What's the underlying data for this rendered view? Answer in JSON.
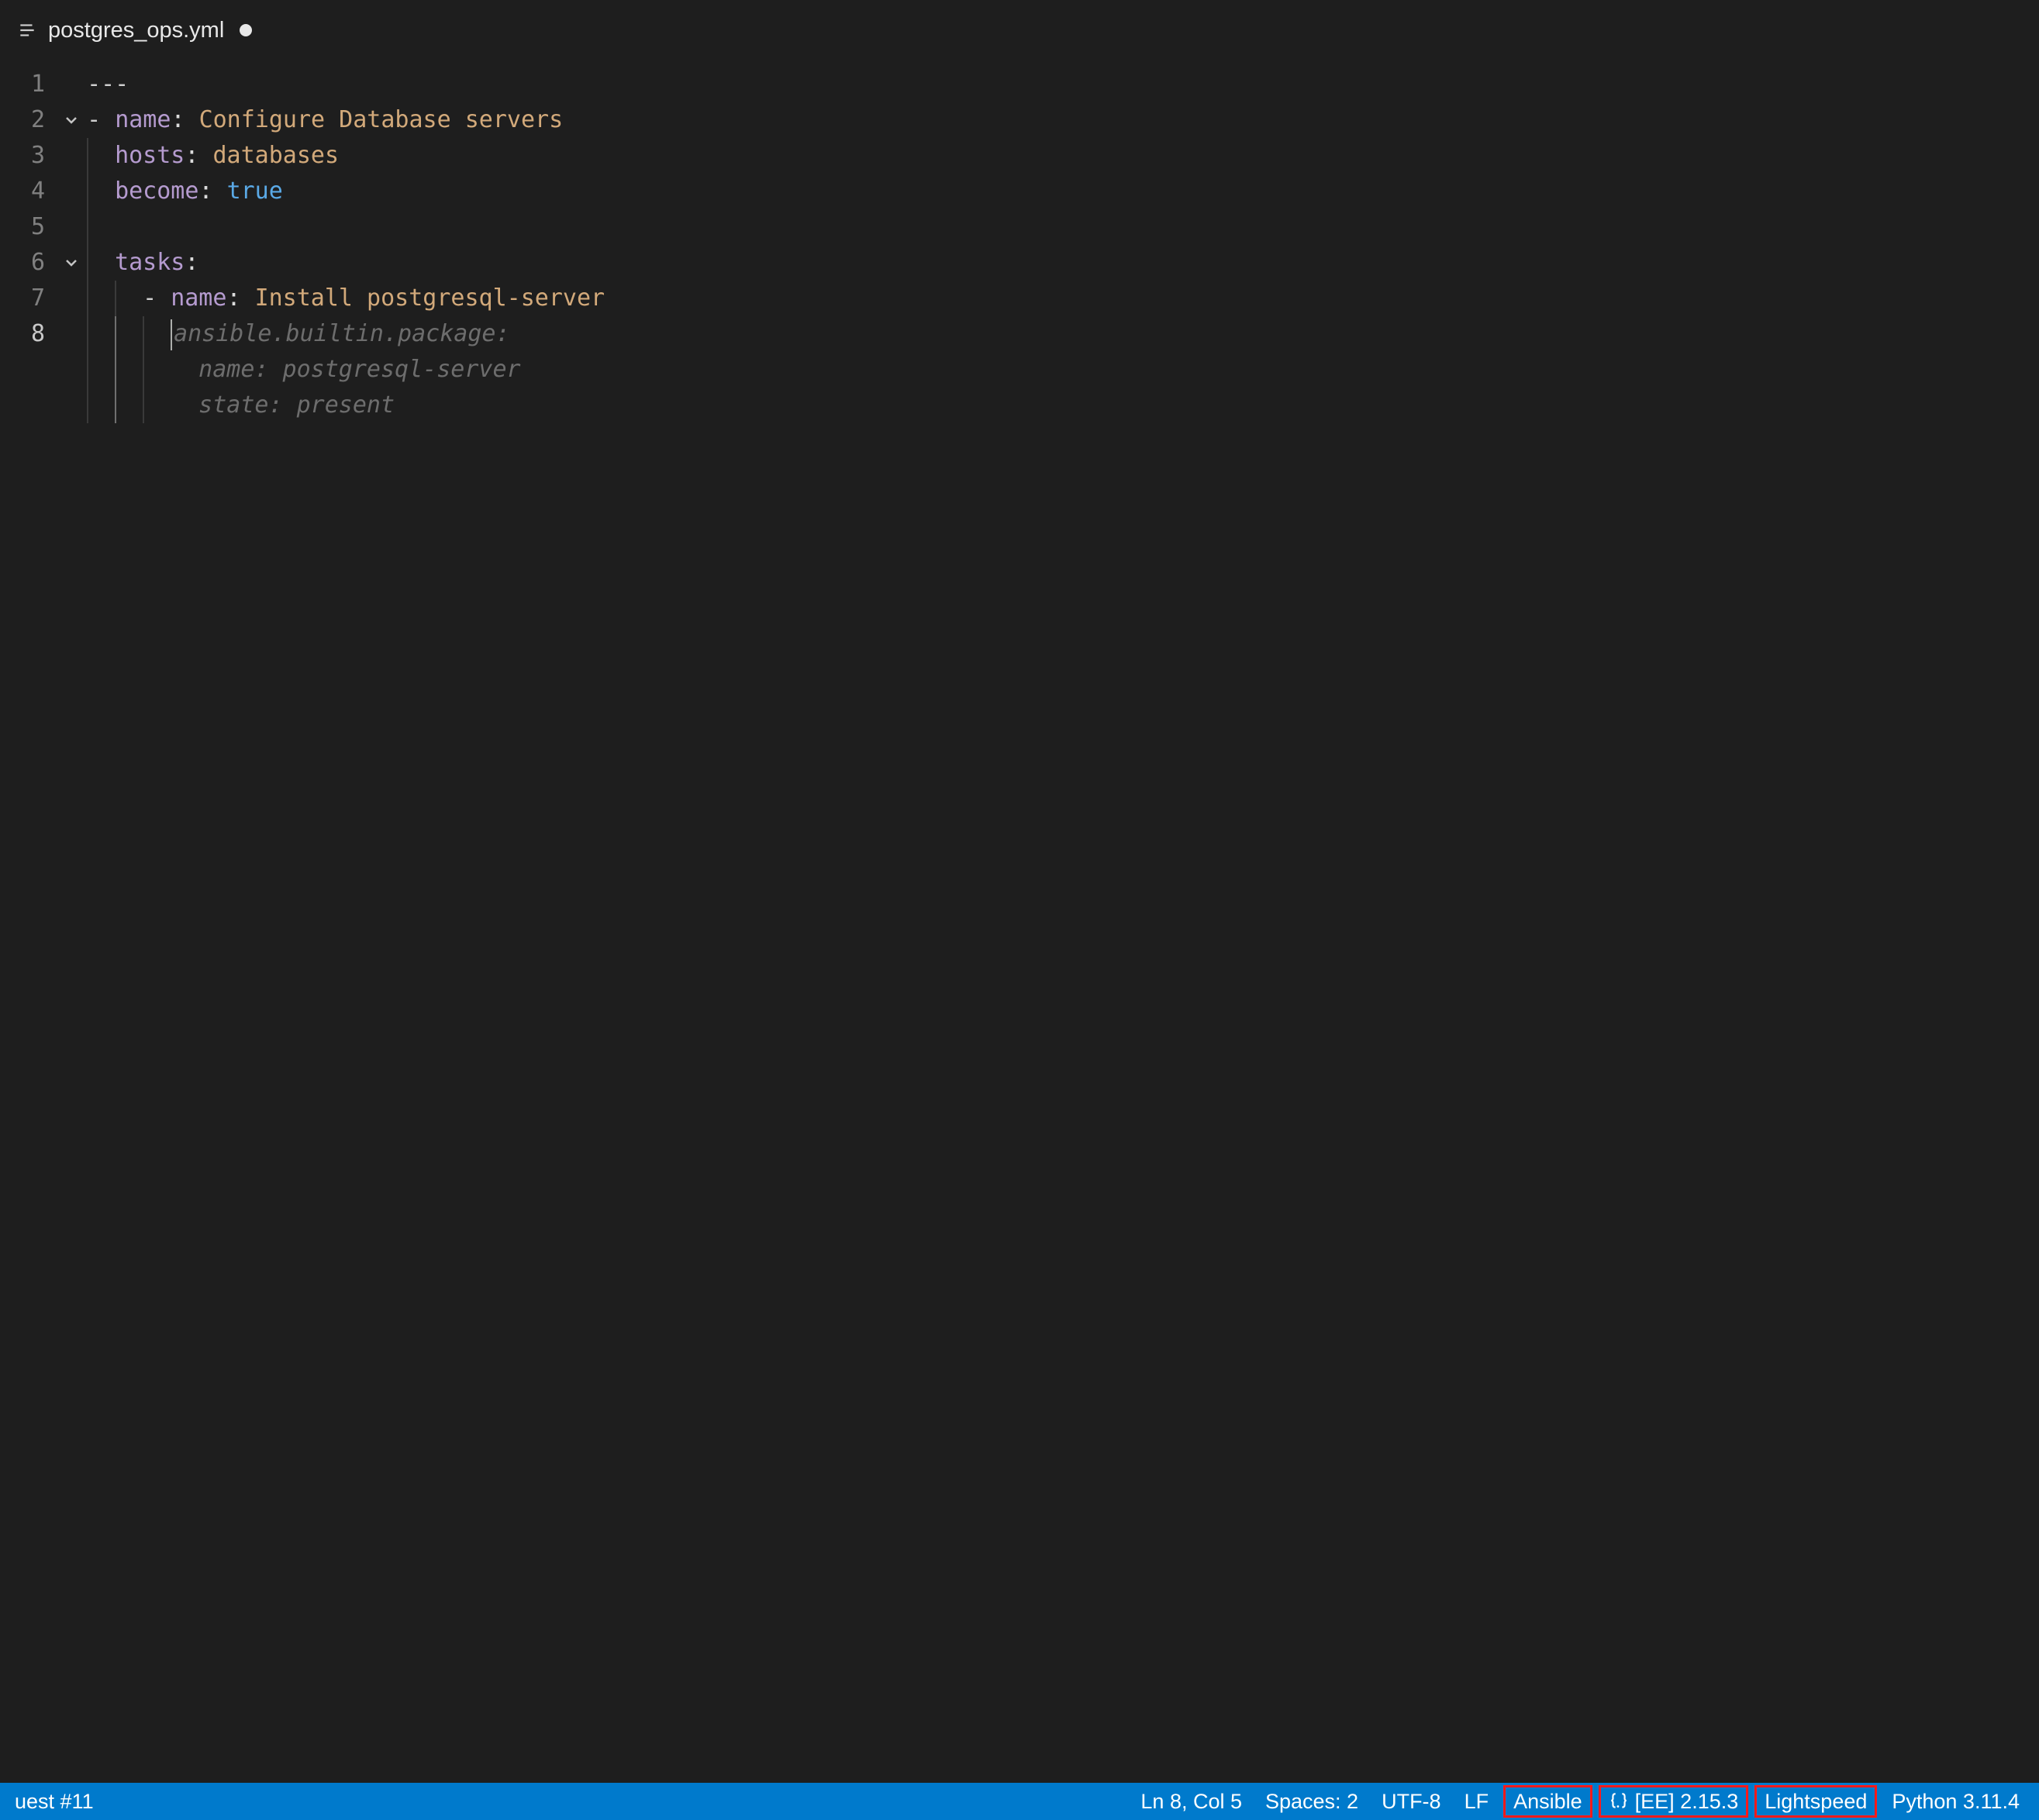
{
  "tab": {
    "filename": "postgres_ops.yml",
    "dirty": true
  },
  "editor": {
    "lines": [
      {
        "num": "1",
        "tokens": [
          {
            "cls": "punct-dash",
            "text": "---"
          }
        ],
        "indent": 0,
        "fold": null
      },
      {
        "num": "2",
        "tokens": [
          {
            "cls": "punct-dash",
            "text": "- "
          },
          {
            "cls": "key",
            "text": "name"
          },
          {
            "cls": "colon",
            "text": ": "
          },
          {
            "cls": "string",
            "text": "Configure Database servers"
          }
        ],
        "indent": 0,
        "fold": "open"
      },
      {
        "num": "3",
        "tokens": [
          {
            "cls": "key",
            "text": "hosts"
          },
          {
            "cls": "colon",
            "text": ": "
          },
          {
            "cls": "string",
            "text": "databases"
          }
        ],
        "indent": 2,
        "fold": null
      },
      {
        "num": "4",
        "tokens": [
          {
            "cls": "key",
            "text": "become"
          },
          {
            "cls": "colon",
            "text": ": "
          },
          {
            "cls": "bool",
            "text": "true"
          }
        ],
        "indent": 2,
        "fold": null
      },
      {
        "num": "5",
        "tokens": [],
        "indent": 2,
        "fold": null
      },
      {
        "num": "6",
        "tokens": [
          {
            "cls": "key",
            "text": "tasks"
          },
          {
            "cls": "colon",
            "text": ":"
          }
        ],
        "indent": 2,
        "fold": "open"
      },
      {
        "num": "7",
        "tokens": [
          {
            "cls": "punct-dash",
            "text": "- "
          },
          {
            "cls": "key",
            "text": "name"
          },
          {
            "cls": "colon",
            "text": ": "
          },
          {
            "cls": "string",
            "text": "Install postgresql-server"
          }
        ],
        "indent": 4,
        "fold": null
      },
      {
        "num": "8",
        "tokens": [
          {
            "cls": "ghost",
            "text": "ansible.builtin.package:"
          }
        ],
        "indent": 6,
        "fold": null,
        "current": true,
        "cursor": true
      },
      {
        "num": "",
        "tokens": [
          {
            "cls": "ghost",
            "text": "  name: postgresql-server"
          }
        ],
        "indent": 6,
        "fold": null,
        "ghostline": true
      },
      {
        "num": "",
        "tokens": [
          {
            "cls": "ghost",
            "text": "  state: present"
          }
        ],
        "indent": 6,
        "fold": null,
        "ghostline": true
      }
    ]
  },
  "status": {
    "left": "uest #11",
    "ln_col": "Ln 8, Col 5",
    "spaces": "Spaces: 2",
    "encoding": "UTF-8",
    "eol": "LF",
    "lang": "Ansible",
    "ee": "[EE] 2.15.3",
    "lightspeed": "Lightspeed",
    "python": "Python 3.11.4"
  }
}
